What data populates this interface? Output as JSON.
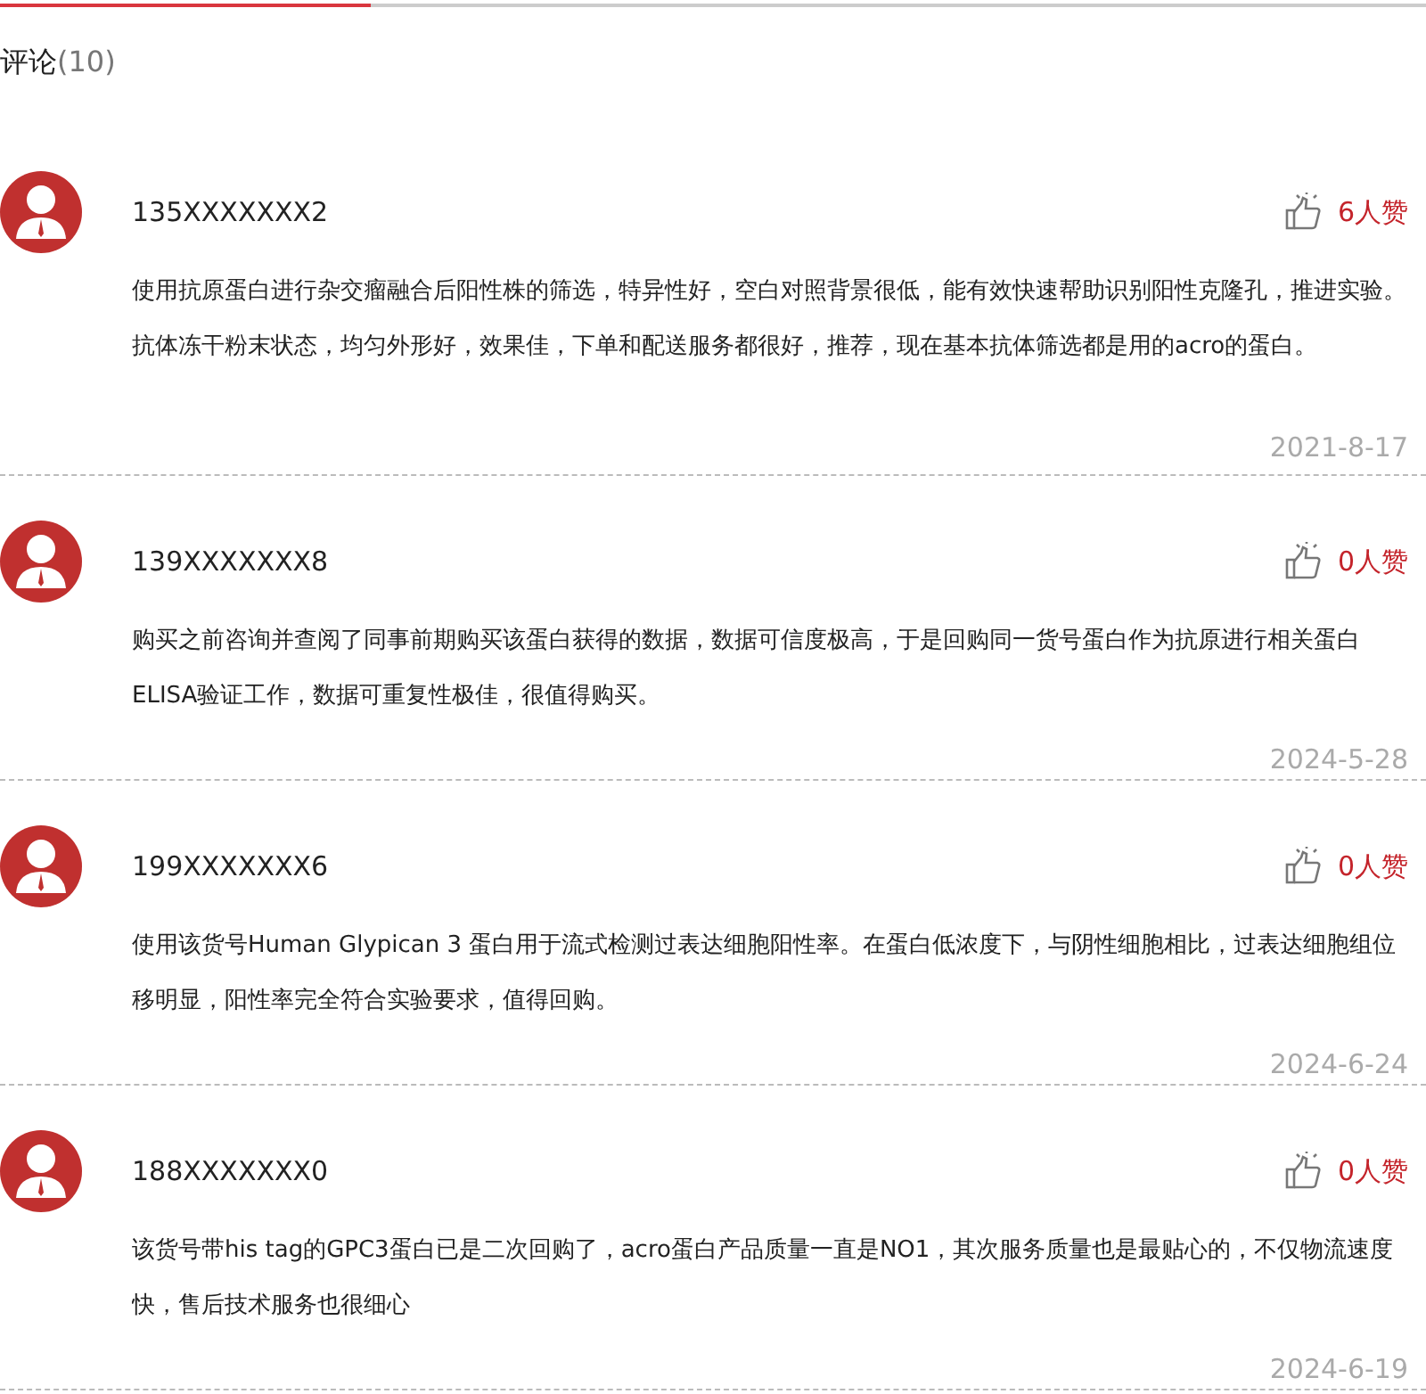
{
  "tab_bar": {
    "level": 0.26
  },
  "heading": {
    "label": "评论",
    "count": "(10)"
  },
  "reviews": [
    {
      "user": "135XXXXXXX2",
      "likes": "6人赞",
      "text": "使用抗原蛋白进行杂交瘤融合后阳性株的筛选，特异性好，空白对照背景很低，能有效快速帮助识别阳性克隆孔，推进实验。抗体冻干粉末状态，均匀外形好，效果佳，下单和配送服务都很好，推荐，现在基本抗体筛选都是用的acro的蛋白。",
      "date": "2021-8-17"
    },
    {
      "user": "139XXXXXXX8",
      "likes": "0人赞",
      "text": "购买之前咨询并查阅了同事前期购买该蛋白获得的数据，数据可信度极高，于是回购同一货号蛋白作为抗原进行相关蛋白ELISA验证工作，数据可重复性极佳，很值得购买。",
      "date": "2024-5-28"
    },
    {
      "user": "199XXXXXXX6",
      "likes": "0人赞",
      "text": "使用该货号Human Glypican 3 蛋白用于流式检测过表达细胞阳性率。在蛋白低浓度下，与阴性细胞相比，过表达细胞组位移明显，阳性率完全符合实验要求，值得回购。",
      "date": "2024-6-24"
    },
    {
      "user": "188XXXXXXX0",
      "likes": "0人赞",
      "text": "该货号带his tag的GPC3蛋白已是二次回购了，acro蛋白产品质量一直是NO1，其次服务质量也是最贴心的，不仅物流速度快，售后技术服务也很细心",
      "date": "2024-6-19"
    }
  ]
}
